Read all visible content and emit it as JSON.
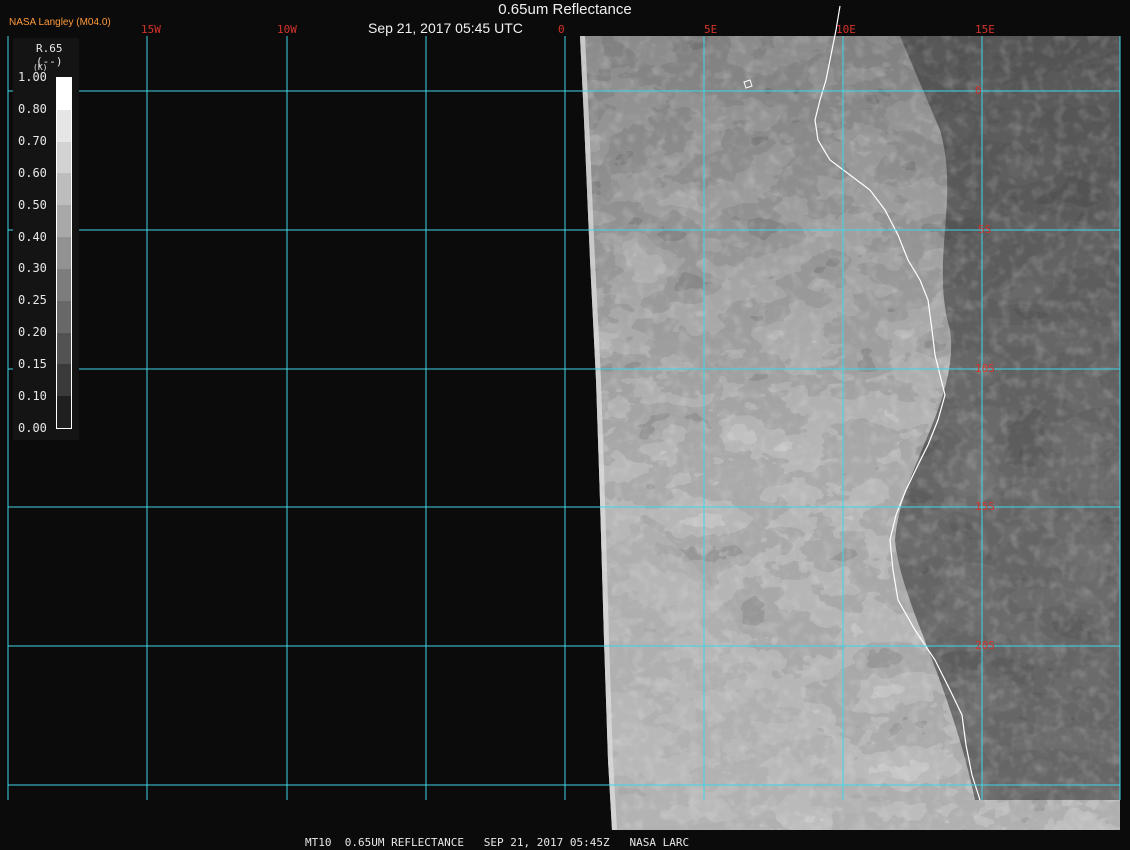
{
  "header": {
    "title": "0.65um Reflectance",
    "datetime": "Sep 21, 2017 05:45 UTC",
    "brand": "NASA Langley (M04.0)"
  },
  "legend": {
    "variable": "R.65",
    "unit": "(--)",
    "unit_prefix": "(K)",
    "ticks": [
      "1.00",
      "0.80",
      "0.70",
      "0.60",
      "0.50",
      "0.40",
      "0.30",
      "0.25",
      "0.20",
      "0.15",
      "0.10",
      "0.00"
    ]
  },
  "map": {
    "longitude_labels": [
      "15W",
      "10W",
      "0",
      "5E",
      "10E",
      "15E"
    ],
    "latitude_labels": [
      "0",
      "5S",
      "10S",
      "15S",
      "20S"
    ],
    "grid_color": "#3fd6e6",
    "label_color": "#d4332c"
  },
  "footer": {
    "text": "MT10  0.65UM REFLECTANCE   SEP 21, 2017 05:45Z   NASA LARC"
  }
}
